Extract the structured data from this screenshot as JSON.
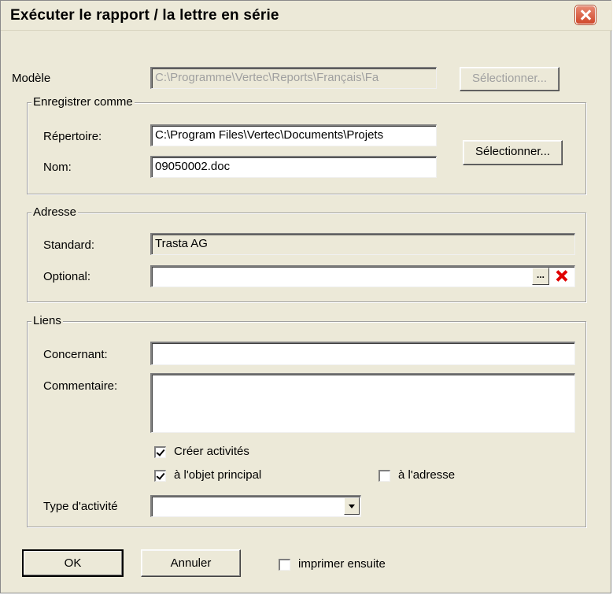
{
  "window": {
    "title": "Exécuter le rapport / la lettre en série"
  },
  "modele": {
    "label": "Modèle",
    "path": "C:\\Programme\\Vertec\\Reports\\Français\\Fa",
    "button": "Sélectionner..."
  },
  "save_as": {
    "legend": "Enregistrer comme",
    "directory_label": "Répertoire:",
    "directory_value": "C:\\Program Files\\Vertec\\Documents\\Projets",
    "name_label": "Nom:",
    "name_value": "09050002.doc",
    "button": "Sélectionner..."
  },
  "address": {
    "legend": "Adresse",
    "standard_label": "Standard:",
    "standard_value": "Trasta AG",
    "optional_label": "Optional:",
    "optional_value": "",
    "browse_button": "...",
    "clear_icon": "red-x-icon"
  },
  "links": {
    "legend": "Liens",
    "concerning_label": "Concernant:",
    "concerning_value": "",
    "comment_label": "Commentaire:",
    "comment_value": "",
    "create_activities_label": "Créer activités",
    "create_activities_checked": true,
    "main_object_label": "à l'objet principal",
    "main_object_checked": true,
    "address_label": "à l'adresse",
    "address_checked": false,
    "activity_type_label": "Type d'activité",
    "activity_type_value": ""
  },
  "footer": {
    "ok": "OK",
    "cancel": "Annuler",
    "print_after_label": "imprimer ensuite",
    "print_after_checked": false
  },
  "colors": {
    "dialog_bg": "#ece9d8",
    "close_button": "#d0482b",
    "clear_icon": "#e00000"
  }
}
